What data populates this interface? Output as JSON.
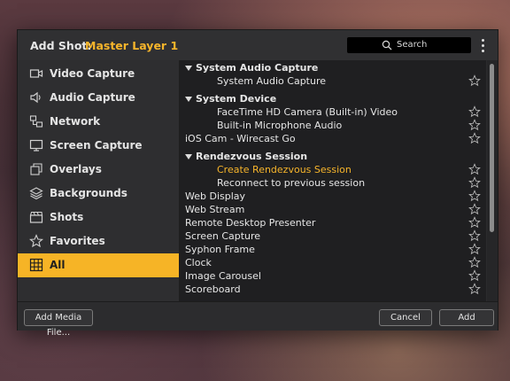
{
  "header": {
    "label": "Add Shot:",
    "layer": "Master Layer 1",
    "search_label": "Search"
  },
  "sidebar": {
    "items": [
      {
        "label": "Video Capture",
        "icon": "video-camera-icon"
      },
      {
        "label": "Audio Capture",
        "icon": "speaker-icon"
      },
      {
        "label": "Network",
        "icon": "network-icon"
      },
      {
        "label": "Screen Capture",
        "icon": "monitor-icon"
      },
      {
        "label": "Overlays",
        "icon": "overlays-icon"
      },
      {
        "label": "Backgrounds",
        "icon": "layers-icon"
      },
      {
        "label": "Shots",
        "icon": "clapperboard-icon"
      },
      {
        "label": "Favorites",
        "icon": "star-icon"
      },
      {
        "label": "All",
        "icon": "grid-icon",
        "active": true
      }
    ]
  },
  "list": {
    "rows": [
      {
        "text": "System Audio Capture",
        "kind": "header"
      },
      {
        "text": "System Audio Capture",
        "kind": "child"
      },
      {
        "text": "System Device",
        "kind": "header"
      },
      {
        "text": "FaceTime HD Camera (Built-in) Video",
        "kind": "child"
      },
      {
        "text": "Built-in Microphone Audio",
        "kind": "child"
      },
      {
        "text": "iOS Cam - Wirecast Go",
        "kind": "item"
      },
      {
        "text": "Rendezvous Session",
        "kind": "header"
      },
      {
        "text": "Create Rendezvous Session",
        "kind": "child",
        "highlight": true
      },
      {
        "text": "Reconnect to previous session",
        "kind": "child"
      },
      {
        "text": "Web Display",
        "kind": "item"
      },
      {
        "text": "Web Stream",
        "kind": "item"
      },
      {
        "text": "Remote Desktop Presenter",
        "kind": "item"
      },
      {
        "text": "Screen Capture",
        "kind": "item"
      },
      {
        "text": "Syphon Frame",
        "kind": "item"
      },
      {
        "text": "Clock",
        "kind": "item"
      },
      {
        "text": "Image Carousel",
        "kind": "item"
      },
      {
        "text": "Scoreboard",
        "kind": "item"
      }
    ]
  },
  "footer": {
    "add_media": "Add Media File...",
    "cancel": "Cancel",
    "add": "Add"
  },
  "colors": {
    "accent": "#f6b426",
    "panel": "#2b2b2d",
    "list_bg": "#1f1f21"
  }
}
